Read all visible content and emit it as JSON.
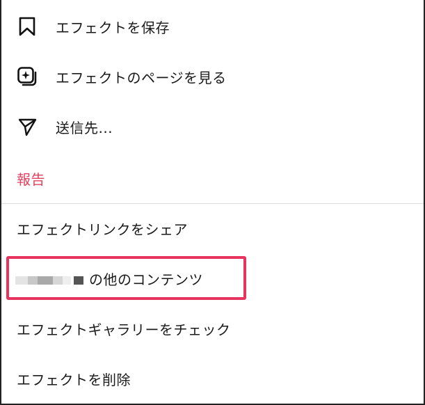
{
  "menu": {
    "top_items": [
      {
        "label": "エフェクトを保存",
        "icon": "bookmark-icon"
      },
      {
        "label": "エフェクトのページを見る",
        "icon": "effect-sparkle-icon"
      },
      {
        "label": "送信先...",
        "icon": "send-icon"
      }
    ],
    "report_label": "報告",
    "bottom_items": [
      {
        "label": "エフェクトリンクをシェア"
      },
      {
        "label": "の他のコンテンツ"
      },
      {
        "label": "エフェクトギャラリーをチェック"
      },
      {
        "label": "エフェクトを削除"
      }
    ]
  },
  "colors": {
    "report": "#e0425f",
    "highlight": "#e8335f"
  }
}
